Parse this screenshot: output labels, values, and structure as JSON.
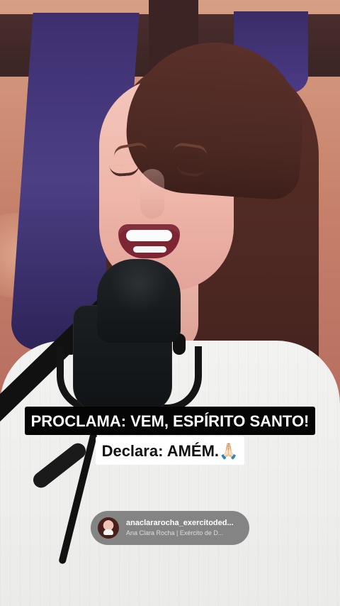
{
  "captions": {
    "line1": "PROCLAMA: VEM, ESPÍRITO SANTO!",
    "line2": "Declara: AMÉM.🙏🏻"
  },
  "creator": {
    "handle": "anaclararocha_exercitoded...",
    "subtitle": "Ana Clara Rocha | Exército de D..."
  }
}
